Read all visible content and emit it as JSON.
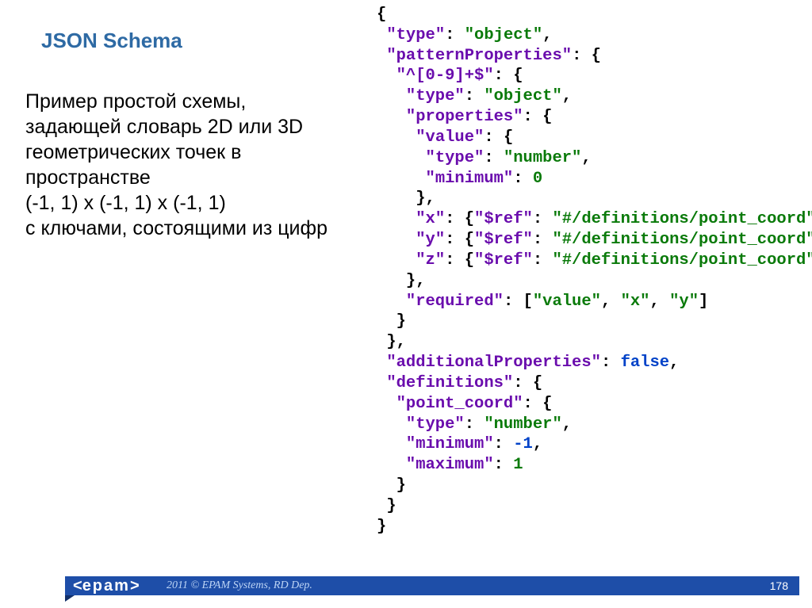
{
  "title": "JSON Schema",
  "description": "Пример простой схемы, задающей словарь 2D или 3D геометрических точек в пространстве\n(-1, 1) x (-1, 1) x (-1, 1)\nс ключами, состоящими из цифр",
  "code": {
    "l1": "{",
    "k_type": "\"type\"",
    "v_object": "\"object\"",
    "k_patternProperties": "\"patternProperties\"",
    "k_pattern": "\"^[0-9]+$\"",
    "k_properties": "\"properties\"",
    "k_value": "\"value\"",
    "v_number": "\"number\"",
    "k_minimum": "\"minimum\"",
    "v_zero": "0",
    "k_x": "\"x\"",
    "k_y": "\"y\"",
    "k_z": "\"z\"",
    "k_ref": "\"$ref\"",
    "v_ref": "\"#/definitions/point_coord\"",
    "k_required": "\"required\"",
    "req_v": "\"value\"",
    "req_x": "\"x\"",
    "req_y": "\"y\"",
    "k_additionalProperties": "\"additionalProperties\"",
    "v_false": "false",
    "k_definitions": "\"definitions\"",
    "k_point_coord": "\"point_coord\"",
    "v_neg1": "-1",
    "k_maximum": "\"maximum\"",
    "v_pos1": "1"
  },
  "footer": {
    "copyright": "2011 © EPAM Systems, RD Dep.",
    "page": "178",
    "logo": "epam"
  }
}
